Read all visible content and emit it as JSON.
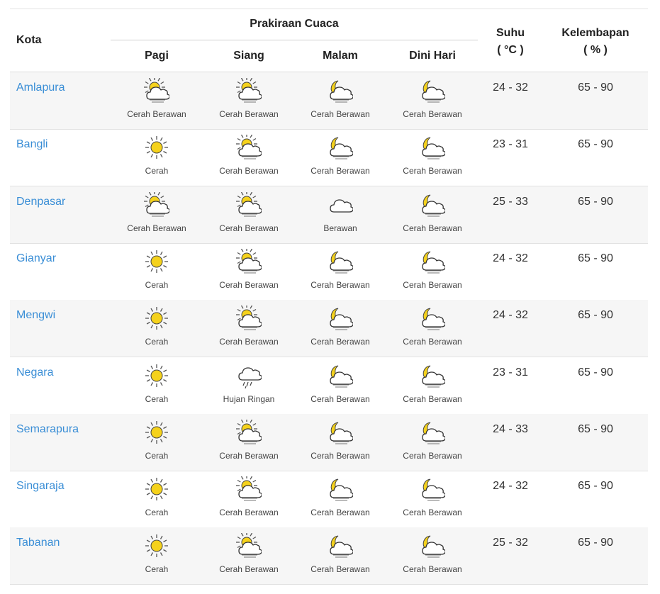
{
  "header": {
    "kota": "Kota",
    "prakiraan": "Prakiraan Cuaca",
    "periods": [
      "Pagi",
      "Siang",
      "Malam",
      "Dini Hari"
    ],
    "suhu_line1": "Suhu",
    "suhu_line2": "( °C )",
    "kel_line1": "Kelembapan",
    "kel_line2": "( % )"
  },
  "colors": {
    "link": "#3a8ed6",
    "sun": "#f5d21c",
    "cloud_stroke": "#333333"
  },
  "rows": [
    {
      "city": "Amlapura",
      "temp": "24 - 32",
      "humidity": "65 - 90",
      "forecast": [
        {
          "label": "Cerah Berawan",
          "icon": "sun-cloud"
        },
        {
          "label": "Cerah Berawan",
          "icon": "sun-cloud"
        },
        {
          "label": "Cerah Berawan",
          "icon": "moon-cloud"
        },
        {
          "label": "Cerah Berawan",
          "icon": "moon-cloud"
        }
      ]
    },
    {
      "city": "Bangli",
      "temp": "23 - 31",
      "humidity": "65 - 90",
      "forecast": [
        {
          "label": "Cerah",
          "icon": "sun"
        },
        {
          "label": "Cerah Berawan",
          "icon": "sun-cloud"
        },
        {
          "label": "Cerah Berawan",
          "icon": "moon-cloud"
        },
        {
          "label": "Cerah Berawan",
          "icon": "moon-cloud"
        }
      ]
    },
    {
      "city": "Denpasar",
      "temp": "25 - 33",
      "humidity": "65 - 90",
      "forecast": [
        {
          "label": "Cerah Berawan",
          "icon": "sun-cloud"
        },
        {
          "label": "Cerah Berawan",
          "icon": "sun-cloud"
        },
        {
          "label": "Berawan",
          "icon": "cloud"
        },
        {
          "label": "Cerah Berawan",
          "icon": "moon-cloud"
        }
      ]
    },
    {
      "city": "Gianyar",
      "temp": "24 - 32",
      "humidity": "65 - 90",
      "forecast": [
        {
          "label": "Cerah",
          "icon": "sun"
        },
        {
          "label": "Cerah Berawan",
          "icon": "sun-cloud"
        },
        {
          "label": "Cerah Berawan",
          "icon": "moon-cloud"
        },
        {
          "label": "Cerah Berawan",
          "icon": "moon-cloud"
        }
      ]
    },
    {
      "city": "Mengwi",
      "temp": "24 - 32",
      "humidity": "65 - 90",
      "forecast": [
        {
          "label": "Cerah",
          "icon": "sun"
        },
        {
          "label": "Cerah Berawan",
          "icon": "sun-cloud"
        },
        {
          "label": "Cerah Berawan",
          "icon": "moon-cloud"
        },
        {
          "label": "Cerah Berawan",
          "icon": "moon-cloud"
        }
      ]
    },
    {
      "city": "Negara",
      "temp": "23 - 31",
      "humidity": "65 - 90",
      "forecast": [
        {
          "label": "Cerah",
          "icon": "sun"
        },
        {
          "label": "Hujan Ringan",
          "icon": "rain-cloud"
        },
        {
          "label": "Cerah Berawan",
          "icon": "moon-cloud"
        },
        {
          "label": "Cerah Berawan",
          "icon": "moon-cloud"
        }
      ]
    },
    {
      "city": "Semarapura",
      "temp": "24 - 33",
      "humidity": "65 - 90",
      "forecast": [
        {
          "label": "Cerah",
          "icon": "sun"
        },
        {
          "label": "Cerah Berawan",
          "icon": "sun-cloud"
        },
        {
          "label": "Cerah Berawan",
          "icon": "moon-cloud"
        },
        {
          "label": "Cerah Berawan",
          "icon": "moon-cloud"
        }
      ]
    },
    {
      "city": "Singaraja",
      "temp": "24 - 32",
      "humidity": "65 - 90",
      "forecast": [
        {
          "label": "Cerah",
          "icon": "sun"
        },
        {
          "label": "Cerah Berawan",
          "icon": "sun-cloud"
        },
        {
          "label": "Cerah Berawan",
          "icon": "moon-cloud"
        },
        {
          "label": "Cerah Berawan",
          "icon": "moon-cloud"
        }
      ]
    },
    {
      "city": "Tabanan",
      "temp": "25 - 32",
      "humidity": "65 - 90",
      "forecast": [
        {
          "label": "Cerah",
          "icon": "sun"
        },
        {
          "label": "Cerah Berawan",
          "icon": "sun-cloud"
        },
        {
          "label": "Cerah Berawan",
          "icon": "moon-cloud"
        },
        {
          "label": "Cerah Berawan",
          "icon": "moon-cloud"
        }
      ]
    }
  ]
}
